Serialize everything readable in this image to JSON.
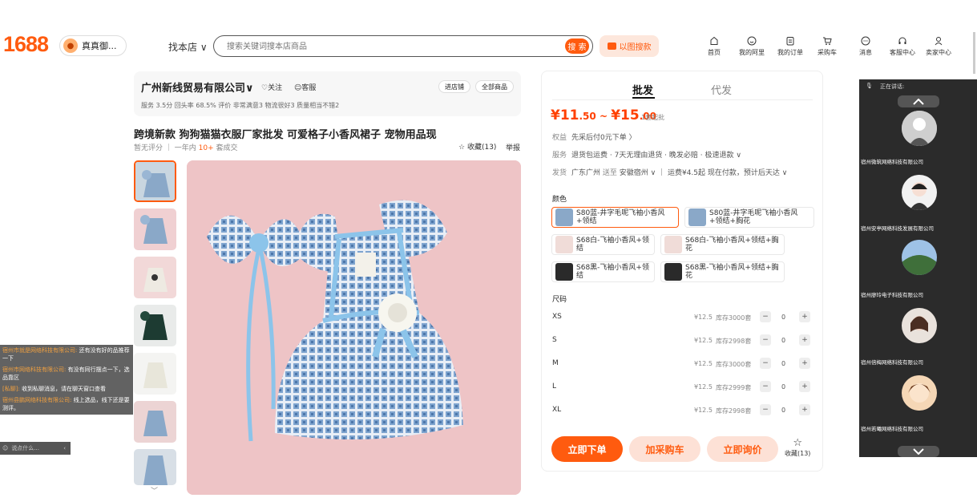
{
  "header": {
    "logo": "1688",
    "shop_button": "真真御...",
    "find_shop": "找本店 ∨",
    "search_placeholder": "搜索关键词搜本店商品",
    "search_button": "搜 索",
    "image_search": "以图搜款",
    "nav": [
      {
        "label": "首页",
        "icon": "home-icon"
      },
      {
        "label": "我的阿里",
        "icon": "user-smile-icon"
      },
      {
        "label": "我的订单",
        "icon": "order-icon"
      },
      {
        "label": "采购车",
        "icon": "cart-icon"
      },
      {
        "label": "消息",
        "icon": "message-icon"
      },
      {
        "label": "客服中心",
        "icon": "headset-icon"
      },
      {
        "label": "卖家中心",
        "icon": "seller-icon"
      }
    ]
  },
  "shop": {
    "name": "广州新线贸易有限公司",
    "follow": "关注",
    "service": "客服",
    "enter_shop": "进店铺",
    "all_products": "全部商品",
    "ratings": "服务 3.5分 回头率 68.5% 评价 非常满意3 物流很好3 质量相当不错2"
  },
  "product": {
    "title": "跨境新款 狗狗猫猫衣服厂家批发 可爱格子小香风裙子 宠物用品现",
    "no_rating": "暂无评分",
    "year_label": "一年内",
    "sold_count": "10+",
    "sold_suffix": "套成交",
    "favorite": "收藏(13)",
    "report": "举报"
  },
  "panel": {
    "tab_wholesale": "批发",
    "tab_dropship": "代发",
    "price_low_big": "¥11",
    "price_low_small": ".50",
    "price_sep": " ~ ",
    "price_high_big": "¥15",
    "price_high_small": ".00",
    "min_qty": "1套起批",
    "rights_key": "权益",
    "rights_value": "先采后付0元下单 〉",
    "service_key": "服务",
    "service_value": "退货包运费 · 7天无理由退货 · 晚发必赔 · 极速退款 ∨",
    "ship_key": "发货",
    "ship_from": "广东广州",
    "ship_to_word": "送至",
    "ship_to": "安徽宿州 ∨",
    "ship_rest": "运费¥4.5起 现在付款，预计后天达 ∨",
    "color_title": "颜色",
    "colors": [
      {
        "label": "S80蓝-井字毛呢飞袖小香风+领结",
        "selected": true
      },
      {
        "label": "S80蓝-井字毛呢飞袖小香风+领结+胸花",
        "selected": false
      },
      {
        "label": "S68白-飞袖小香风+领结",
        "selected": false
      },
      {
        "label": "S68白-飞袖小香风+领结+胸花",
        "selected": false
      },
      {
        "label": "S68黑-飞袖小香风+领结",
        "selected": false
      },
      {
        "label": "S68黑-飞袖小香风+领结+胸花",
        "selected": false
      }
    ],
    "size_title": "尺码",
    "sizes": [
      {
        "size": "XS",
        "price": "¥12.5",
        "stock": "库存3000套",
        "qty": "0"
      },
      {
        "size": "S",
        "price": "¥12.5",
        "stock": "库存2998套",
        "qty": "0"
      },
      {
        "size": "M",
        "price": "¥12.5",
        "stock": "库存3000套",
        "qty": "0"
      },
      {
        "size": "L",
        "price": "¥12.5",
        "stock": "库存2999套",
        "qty": "0"
      },
      {
        "size": "XL",
        "price": "¥12.5",
        "stock": "库存2998套",
        "qty": "0"
      }
    ],
    "minus": "−",
    "plus": "+",
    "order_now": "立即下单",
    "add_cart": "加采购车",
    "inquire": "立即询价",
    "favorite": "收藏(13)"
  },
  "chat": {
    "messages": [
      {
        "name": "宿州市就是网络科技有限公司:",
        "text": "还有没有好的品推荐一下"
      },
      {
        "name": "宿州市网络科技有限公司:",
        "text": "有没有同行摆点一下，选品靠区"
      },
      {
        "name": "[私聊]:",
        "text": "收到私聊消息，请在聊天窗口查看"
      },
      {
        "name": "宿州县鹏网络科技有限公司:",
        "text": "线上选品，线下还是要测评。"
      }
    ],
    "input_placeholder": "说点什么..."
  },
  "video": {
    "header": "正在讲话:",
    "participants": [
      {
        "name": "宿州微筑网络科技有限公司"
      },
      {
        "name": "宿州安亭网络科技发展有限公司"
      },
      {
        "name": "宿州廖玲电子科技有限公司"
      },
      {
        "name": "宿州倍梅网络科技有限公司"
      },
      {
        "name": "宿州若曦网络科技有限公司"
      }
    ]
  },
  "colors": {
    "brand": "#ff5b0f",
    "price": "#ff4000",
    "pink_bg": "#eec4c6"
  }
}
